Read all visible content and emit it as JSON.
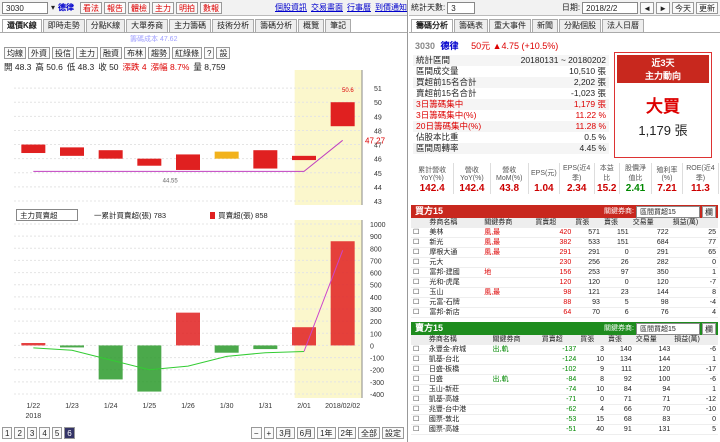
{
  "left": {
    "stock_code": "3030",
    "stock_name": "德律",
    "top_buttons": [
      "看法",
      "報告",
      "體檢",
      "主力",
      "明拍",
      "數報"
    ],
    "top_links": [
      "個股資訊",
      "交易畫面",
      "行事曆",
      "到價通知"
    ],
    "tabs": [
      "還價K線",
      "即時走勢",
      "分點K線",
      "大單券商",
      "主力籌碼",
      "技術分析",
      "籌碼分析",
      "概覽",
      "筆記"
    ],
    "cost_label": "籌碼成本 47.62",
    "indicator_buttons": [
      "均線",
      "外資",
      "投信",
      "主力",
      "融資",
      "布林",
      "趨勢",
      "紅綠條",
      "?",
      "設"
    ],
    "ohlc": {
      "open": "開 48.3",
      "high": "高 50.6",
      "low": "低 48.3",
      "close": "收 50",
      "change": "漲跌 4",
      "pct": "漲幅 8.7%",
      "vol": "量 8,759"
    },
    "price_tag": "47.27",
    "peak_tag": "50.6",
    "trough_tag": "44.55",
    "lower_select": "主力買賣超",
    "lower_legend1": "一累計買賣超(張) 783",
    "lower_legend2": "買賣超(張) 858",
    "x_labels": [
      "1/22",
      "1/23",
      "1/24",
      "1/25",
      "1/26",
      "1/30",
      "1/31",
      "2/01",
      "2018/02/02"
    ],
    "year_label": "2018",
    "pages": [
      "1",
      "2",
      "3",
      "4",
      "5",
      "6"
    ],
    "period_buttons": [
      "3月",
      "6月",
      "1年",
      "2年",
      "全部",
      "設定"
    ]
  },
  "chart_data": [
    {
      "type": "bar",
      "title": "",
      "ylim": [
        43,
        52
      ],
      "y_ticks": [
        "51",
        "50",
        "49",
        "48",
        "47",
        "46",
        "45",
        "44",
        "43"
      ],
      "candles": [
        [
          47,
          46.4
        ],
        [
          46.8,
          46.2
        ],
        [
          46.6,
          46
        ],
        [
          46,
          45.5
        ],
        [
          45.2,
          46.3
        ],
        [
          46.5,
          46
        ],
        [
          46.6,
          45.3
        ],
        [
          46.2,
          45.9
        ],
        [
          48.3,
          50
        ]
      ],
      "highlight_price": 47.27
    },
    {
      "type": "bar",
      "title": "",
      "ylim": [
        -400,
        1000
      ],
      "y_ticks": [
        "1000",
        "900",
        "800",
        "700",
        "600",
        "500",
        "400",
        "300",
        "200",
        "100",
        "0",
        "-100",
        "-200",
        "-300",
        "-400"
      ],
      "values": [
        20,
        -10,
        -280,
        -380,
        270,
        -60,
        -30,
        150,
        858
      ],
      "cumulative": [
        -20,
        -40,
        -120,
        -200,
        -170,
        -90,
        -60,
        -50,
        783
      ]
    }
  ],
  "right": {
    "days_label": "統計天數:",
    "days": "3",
    "date_label": "日期:",
    "date": "2018/2/2",
    "today": "今天",
    "update": "更新",
    "tabs": [
      "籌碼分析",
      "籌碼表",
      "重大事件",
      "新聞",
      "分點個股",
      "法人日曆"
    ],
    "code": "3030",
    "name": "德律",
    "price_change": "50元 ▲4.75 (+10.5%)",
    "stats": [
      [
        "統計區間",
        "20180131 ~ 20180202"
      ],
      [
        "區間成交量",
        "10,510 張"
      ],
      [
        "買超前15名合計",
        "2,202 張"
      ],
      [
        "賣超前15名合計",
        "-1,023 張"
      ],
      [
        "3日籌碼集中",
        "1,179 張"
      ],
      [
        "3日籌碼集中(%)",
        "11.22 %"
      ],
      [
        "20日籌碼集中(%)",
        "11.28 %"
      ],
      [
        "佔股本比重",
        "0.5 %"
      ],
      [
        "區間周轉率",
        "4.45 %"
      ]
    ],
    "badge_title": "近3天\n主力動向",
    "badge_action": "大買",
    "badge_value": "1,179 張",
    "summary_heads": [
      "累計營收YoY(%)",
      "營收YoY(%)",
      "營收MoM(%)",
      "EPS(元)",
      "EPS(近4季)",
      "本益比",
      "股價淨值比",
      "殖利率(%)",
      "ROE(近4季)"
    ],
    "summary_vals": [
      "142.4",
      "142.4",
      "43.8",
      "1.04",
      "2.34",
      "15.2",
      "2.41",
      "7.21",
      "11.3"
    ],
    "buy_title": "買方15",
    "sell_title": "賣方15",
    "cond_label": "關鍵券商:",
    "cond_select": "區間買超15",
    "btn": "欄",
    "cols": [
      "券商名稱",
      "關鍵券商",
      "買賣超",
      "買張",
      "賣張",
      "交易量",
      "損益(萬)"
    ],
    "buy_rows": [
      [
        "美林",
        "風,最",
        "420",
        "571",
        "151",
        "722",
        "25"
      ],
      [
        "新光",
        "風,最",
        "382",
        "533",
        "151",
        "684",
        "77"
      ],
      [
        "摩根大通",
        "風,最",
        "291",
        "291",
        "0",
        "291",
        "65"
      ],
      [
        "元大",
        "",
        "230",
        "256",
        "26",
        "282",
        "0"
      ],
      [
        "富邦-建國",
        "地",
        "156",
        "253",
        "97",
        "350",
        "1"
      ],
      [
        "光和-虎尾",
        "",
        "120",
        "120",
        "0",
        "120",
        "-7"
      ],
      [
        "玉山",
        "風,最",
        "98",
        "121",
        "23",
        "144",
        "8"
      ],
      [
        "元富-石牌",
        "",
        "88",
        "93",
        "5",
        "98",
        "-4"
      ],
      [
        "富邦-新店",
        "",
        "64",
        "70",
        "6",
        "76",
        "4"
      ]
    ],
    "sell_rows": [
      [
        "永豐金-府城",
        "出,軌",
        "-137",
        "3",
        "140",
        "143",
        "-6"
      ],
      [
        "凱基-台北",
        "",
        "-124",
        "10",
        "134",
        "144",
        "1"
      ],
      [
        "日盛-板橋",
        "",
        "-102",
        "9",
        "111",
        "120",
        "-17"
      ],
      [
        "日盛",
        "出,軌",
        "-84",
        "8",
        "92",
        "100",
        "-6"
      ],
      [
        "玉山-新莊",
        "",
        "-74",
        "10",
        "84",
        "94",
        "1"
      ],
      [
        "凱基-高雄",
        "",
        "-71",
        "0",
        "71",
        "71",
        "-12"
      ],
      [
        "兆豐-台中港",
        "",
        "-62",
        "4",
        "66",
        "70",
        "-10"
      ],
      [
        "國票-敦北",
        "",
        "-53",
        "15",
        "68",
        "83",
        "0"
      ],
      [
        "國票-高雄",
        "",
        "-51",
        "40",
        "91",
        "131",
        "5"
      ]
    ]
  },
  "colors": {
    "up": "#e02020",
    "down": "#2c9a2c",
    "buy_header": "#c8281e",
    "sell_header": "#1e8c1e",
    "highlight": "#fbf7cc",
    "ma": "#c040c0"
  }
}
